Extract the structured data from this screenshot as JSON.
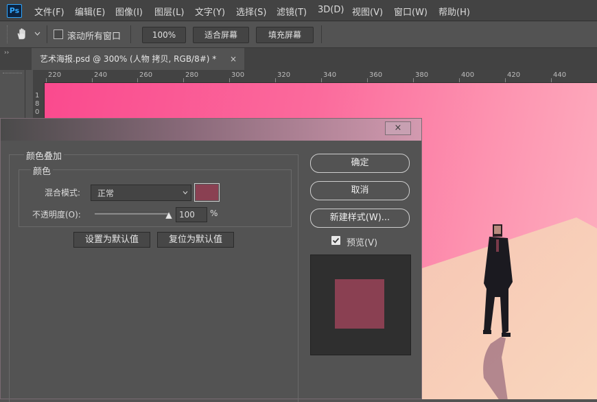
{
  "app": {
    "logo": "Ps"
  },
  "menu": [
    "文件(F)",
    "编辑(E)",
    "图像(I)",
    "图层(L)",
    "文字(Y)",
    "选择(S)",
    "滤镜(T)",
    "3D(D)",
    "视图(V)",
    "窗口(W)",
    "帮助(H)"
  ],
  "options": {
    "scroll_all_windows": "滚动所有窗口",
    "zoom_value": "100%",
    "fit_screen": "适合屏幕",
    "fill_screen": "填充屏幕"
  },
  "document_tab": {
    "title": "艺术海报.psd @ 300% (人物 拷贝, RGB/8#) *",
    "close": "×"
  },
  "ruler": {
    "h_ticks": [
      "220",
      "240",
      "260",
      "280",
      "300",
      "320",
      "340",
      "360",
      "380",
      "400",
      "420",
      "440"
    ],
    "v_digits": [
      "1",
      "8",
      "0"
    ]
  },
  "dialog": {
    "close": "×",
    "section_title": "颜色叠加",
    "group_title": "颜色",
    "blend_mode_label": "混合模式:",
    "blend_mode_value": "正常",
    "opacity_label": "不透明度(O):",
    "opacity_value": "100",
    "opacity_unit": "%",
    "opacity_fraction": 1.0,
    "set_default": "设置为默认值",
    "reset_default": "复位为默认值",
    "ok": "确定",
    "cancel": "取消",
    "new_style": "新建样式(W)...",
    "preview_label": "预览(V)",
    "preview_checked": true
  },
  "colors": {
    "overlay_color": "#8a4052",
    "canvas_pink": "#fa4a8e",
    "floor_peach": "#f7c8b2",
    "panel_bg": "#535353"
  },
  "icons": [
    "ps-logo-icon",
    "hand-tool-icon",
    "chevron-down-icon",
    "move-tool-icon",
    "marquee-tool-icon",
    "lasso-tool-icon",
    "close-icon",
    "dropdown-arrow-icon",
    "checkbox-icon",
    "slider-handle-icon"
  ]
}
